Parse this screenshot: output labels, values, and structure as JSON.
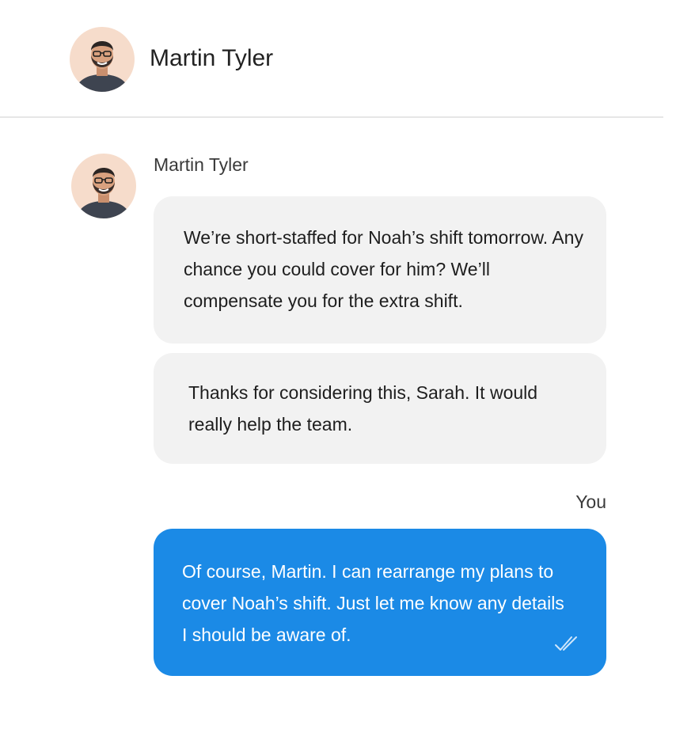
{
  "header": {
    "contact_name": "Martin Tyler"
  },
  "conversation": {
    "incoming": {
      "sender_name": "Martin Tyler",
      "messages": [
        "We’re short-staffed for Noah’s shift tomorrow. Any chance you could cover for him? We’ll compensate you for the extra shift.",
        "Thanks for considering this, Sarah. It would really help the team."
      ]
    },
    "outgoing": {
      "sender_label": "You",
      "messages": [
        "Of course, Martin. I can rearrange my plans to cover Noah’s shift. Just let me know any details I should be aware of."
      ],
      "status_icon": "double-check-read-icon"
    }
  },
  "colors": {
    "incoming_bubble": "#f2f2f2",
    "outgoing_bubble": "#1b8ae6",
    "divider": "#e6e6e6",
    "avatar_background": "#f6dccb"
  }
}
